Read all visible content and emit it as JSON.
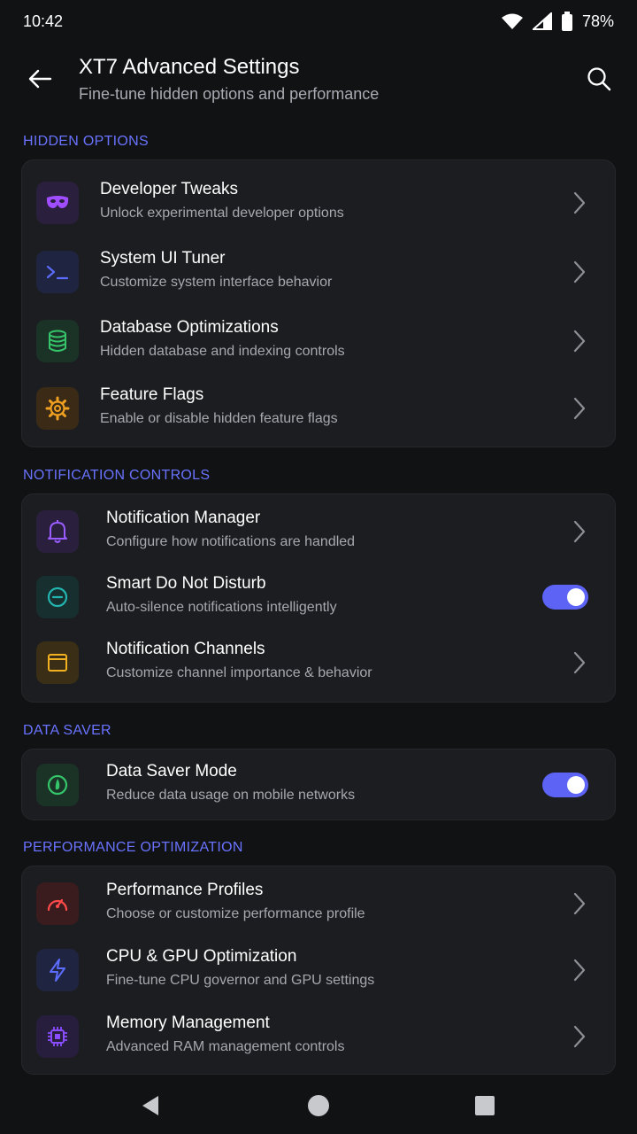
{
  "status_bar": {
    "time": "10:42",
    "battery": "78%"
  },
  "app_bar": {
    "title": "XT7 Advanced Settings",
    "subtitle": "Fine-tune hidden options and performance"
  },
  "sections": {
    "hidden": {
      "header": "HIDDEN OPTIONS",
      "items": [
        {
          "title": "Developer Tweaks",
          "subtitle": "Unlock experimental developer options",
          "icon": "mask-icon",
          "color": "#a04dff"
        },
        {
          "title": "System UI Tuner",
          "subtitle": "Customize system interface behavior",
          "icon": "terminal-icon",
          "color": "#5b6cff"
        },
        {
          "title": "Database Optimizations",
          "subtitle": "Hidden database and indexing controls",
          "icon": "database-icon",
          "color": "#36c46b"
        },
        {
          "title": "Feature Flags",
          "subtitle": "Enable or disable hidden feature flags",
          "icon": "gear-icon",
          "color": "#f0a020"
        }
      ]
    },
    "notifications": {
      "header": "NOTIFICATION CONTROLS",
      "items": [
        {
          "title": "Notification Manager",
          "subtitle": "Configure how notifications are handled",
          "icon": "bell-icon",
          "color": "#9a5cff",
          "control": "chevron"
        },
        {
          "title": "Smart Do Not Disturb",
          "subtitle": "Auto-silence notifications intelligently",
          "icon": "dnd-icon",
          "color": "#22b5b0",
          "control": "toggle",
          "on": true
        },
        {
          "title": "Notification Channels",
          "subtitle": "Customize channel importance & behavior",
          "icon": "window-icon",
          "color": "#f0b020",
          "control": "chevron"
        }
      ]
    },
    "datasaver": {
      "header": "DATA SAVER",
      "items": [
        {
          "title": "Data Saver Mode",
          "subtitle": "Reduce data usage on mobile networks",
          "icon": "data-saver-icon",
          "color": "#36c46b",
          "control": "toggle",
          "on": true
        }
      ]
    },
    "performance": {
      "header": "PERFORMANCE OPTIMIZATION",
      "items": [
        {
          "title": "Performance Profiles",
          "subtitle": "Choose or customize performance profile",
          "icon": "speedometer-icon",
          "color": "#ff4a4a"
        },
        {
          "title": "CPU & GPU Optimization",
          "subtitle": "Fine-tune CPU governor and GPU settings",
          "icon": "bolt-icon",
          "color": "#5b6cff"
        },
        {
          "title": "Memory Management",
          "subtitle": "Advanced RAM management controls",
          "icon": "chip-icon",
          "color": "#8a4dff"
        }
      ]
    }
  }
}
